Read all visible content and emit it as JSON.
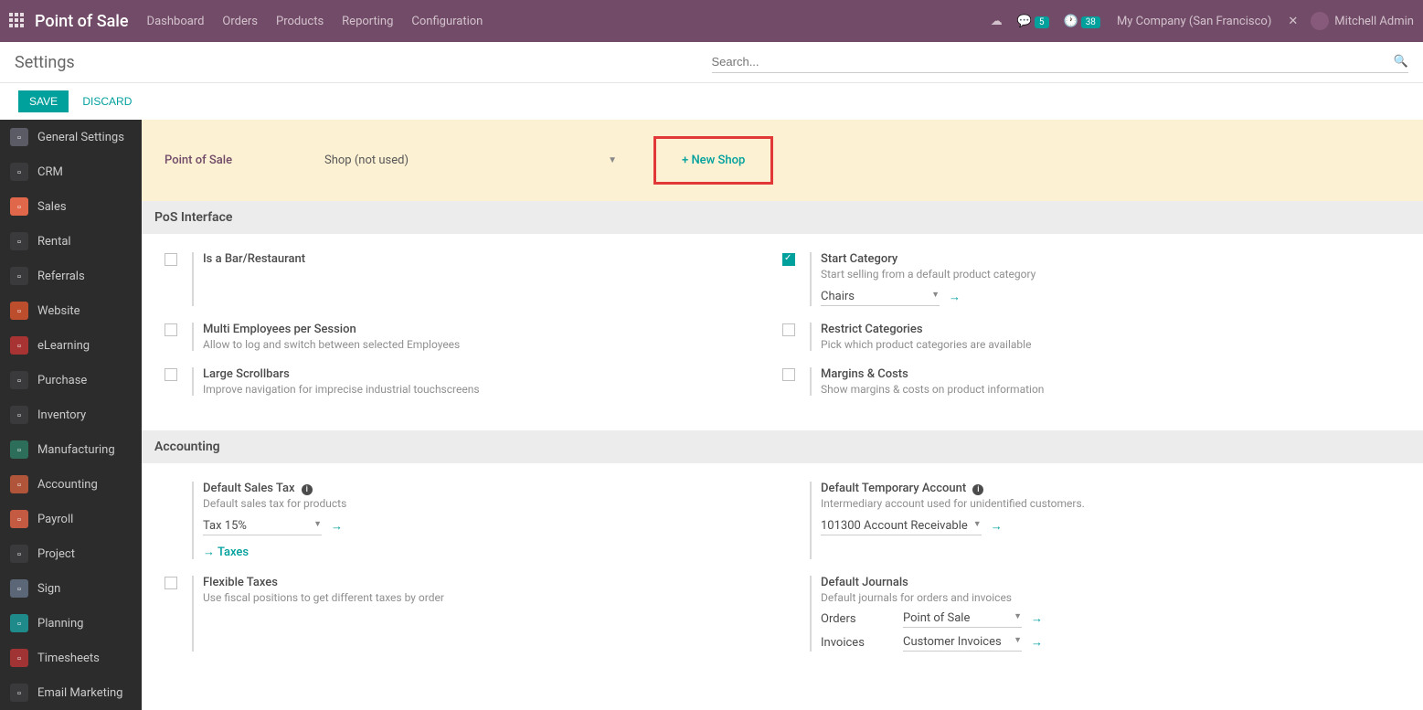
{
  "navbar": {
    "brand": "Point of Sale",
    "links": [
      "Dashboard",
      "Orders",
      "Products",
      "Reporting",
      "Configuration"
    ],
    "chat_badge": "5",
    "activity_badge": "38",
    "company": "My Company (San Francisco)",
    "username": "Mitchell Admin"
  },
  "header": {
    "title": "Settings",
    "search_placeholder": "Search..."
  },
  "actions": {
    "save": "SAVE",
    "discard": "DISCARD"
  },
  "sidebar": {
    "items": [
      {
        "label": "General Settings",
        "color": "#5b5b66"
      },
      {
        "label": "CRM",
        "color": "#3a3a3c"
      },
      {
        "label": "Sales",
        "color": "#e0674a"
      },
      {
        "label": "Rental",
        "color": "#3a3a3c"
      },
      {
        "label": "Referrals",
        "color": "#3a3a3c"
      },
      {
        "label": "Website",
        "color": "#bd4e2d"
      },
      {
        "label": "eLearning",
        "color": "#a83333"
      },
      {
        "label": "Purchase",
        "color": "#3a3a3c"
      },
      {
        "label": "Inventory",
        "color": "#3a3a3c"
      },
      {
        "label": "Manufacturing",
        "color": "#2d6e5a"
      },
      {
        "label": "Accounting",
        "color": "#b0543a"
      },
      {
        "label": "Payroll",
        "color": "#c55a42"
      },
      {
        "label": "Project",
        "color": "#3a3a3c"
      },
      {
        "label": "Sign",
        "color": "#5b6677"
      },
      {
        "label": "Planning",
        "color": "#1e8a8a"
      },
      {
        "label": "Timesheets",
        "color": "#a03333"
      },
      {
        "label": "Email Marketing",
        "color": "#3a3a3c"
      }
    ]
  },
  "config": {
    "field_label": "Point of Sale",
    "selected_shop": "Shop (not used)",
    "new_shop": "+ New Shop"
  },
  "section_pos": "PoS Interface",
  "section_acct": "Accounting",
  "settings": {
    "bar_restaurant": {
      "label": "Is a Bar/Restaurant"
    },
    "start_cat": {
      "label": "Start Category",
      "desc": "Start selling from a default product category",
      "value": "Chairs"
    },
    "multi_emp": {
      "label": "Multi Employees per Session",
      "desc": "Allow to log and switch between selected Employees"
    },
    "restrict_cat": {
      "label": "Restrict Categories",
      "desc": "Pick which product categories are available"
    },
    "large_scroll": {
      "label": "Large Scrollbars",
      "desc": "Improve navigation for imprecise industrial touchscreens"
    },
    "margins": {
      "label": "Margins & Costs",
      "desc": "Show margins & costs on product information"
    },
    "default_tax": {
      "label": "Default Sales Tax",
      "desc": "Default sales tax for products",
      "value": "Tax 15%",
      "link": "Taxes"
    },
    "temp_acct": {
      "label": "Default Temporary Account",
      "desc": "Intermediary account used for unidentified customers.",
      "value": "101300 Account Receivable"
    },
    "flex_tax": {
      "label": "Flexible Taxes",
      "desc": "Use fiscal positions to get different taxes by order"
    },
    "journals": {
      "label": "Default Journals",
      "desc": "Default journals for orders and invoices",
      "orders_label": "Orders",
      "orders_value": "Point of Sale",
      "invoices_label": "Invoices",
      "invoices_value": "Customer Invoices"
    }
  }
}
